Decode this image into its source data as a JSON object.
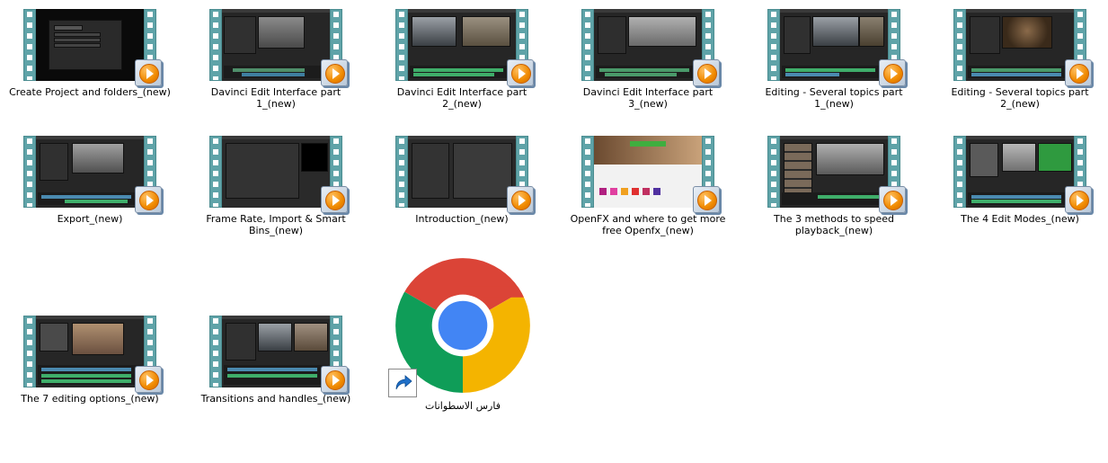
{
  "files": [
    {
      "label": "Create Project and folders_(new)",
      "theme": "dark"
    },
    {
      "label": "Davinci Edit Interface part 1_(new)",
      "theme": "soldiers"
    },
    {
      "label": "Davinci Edit Interface part 2_(new)",
      "theme": "car"
    },
    {
      "label": "Davinci Edit Interface part 3_(new)",
      "theme": "grey"
    },
    {
      "label": "Editing - Several topics part 1_(new)",
      "theme": "car"
    },
    {
      "label": "Editing - Several topics part 2_(new)",
      "theme": "face"
    },
    {
      "label": "Export_(new)",
      "theme": "soldiers"
    },
    {
      "label": "Frame Rate, Import & Smart Bins_(new)",
      "theme": "dark"
    },
    {
      "label": "Introduction_(new)",
      "theme": "panel"
    },
    {
      "label": "OpenFX and where to get more free Openfx_(new)",
      "theme": "web"
    },
    {
      "label": "The 3 methods to speed playback_(new)",
      "theme": "grid"
    },
    {
      "label": "The 4 Edit Modes_(new)",
      "theme": "green"
    },
    {
      "label": "The 7 editing options_(new)",
      "theme": "car"
    },
    {
      "label": "Transitions and handles_(new)",
      "theme": "car"
    }
  ],
  "shortcut": {
    "label": "فارس الاسطوانات",
    "icon": "chrome-icon"
  },
  "colors": {
    "filmstrip": "#5fa3a8",
    "play_badge": "#f08a00",
    "chrome_red": "#db4437",
    "chrome_green": "#0f9d58",
    "chrome_yellow": "#f4b400",
    "chrome_blue": "#4285f4"
  }
}
